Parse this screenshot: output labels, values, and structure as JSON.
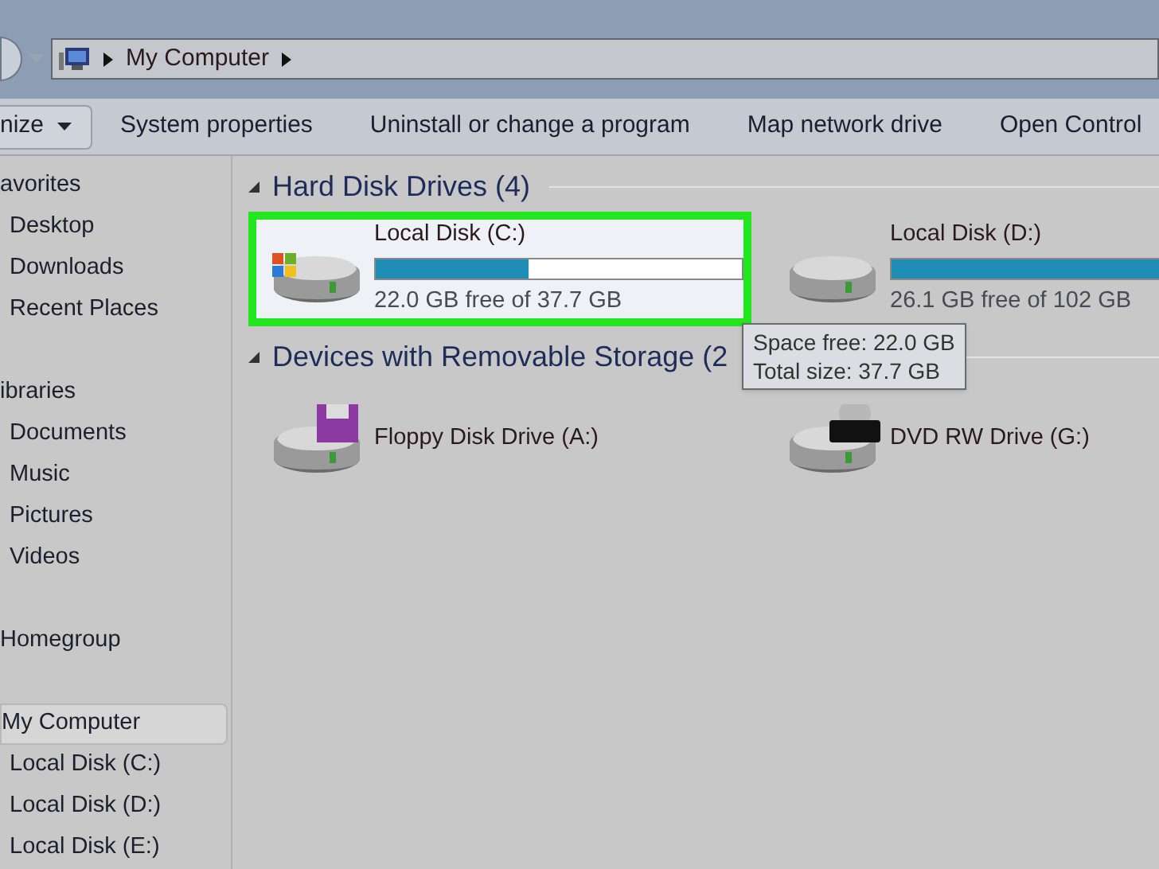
{
  "address_bar": {
    "path": [
      "My Computer"
    ]
  },
  "toolbar": {
    "items": [
      {
        "label": "nize",
        "kind": "menu"
      },
      {
        "label": "System properties",
        "kind": "button"
      },
      {
        "label": "Uninstall or change a program",
        "kind": "button"
      },
      {
        "label": "Map network drive",
        "kind": "button"
      },
      {
        "label": "Open Control",
        "kind": "button"
      }
    ]
  },
  "sidebar": {
    "groups": [
      {
        "label": "avorites",
        "selected": false,
        "children": [
          {
            "label": "Desktop"
          },
          {
            "label": "Downloads"
          },
          {
            "label": "Recent Places"
          }
        ]
      },
      {
        "label": "ibraries",
        "selected": false,
        "children": [
          {
            "label": "Documents"
          },
          {
            "label": "Music"
          },
          {
            "label": "Pictures"
          },
          {
            "label": "Videos"
          }
        ]
      },
      {
        "label": "Homegroup",
        "selected": false
      },
      {
        "label": "My Computer",
        "selected": true,
        "children": [
          {
            "label": "Local Disk (C:)"
          },
          {
            "label": "Local Disk (D:)"
          },
          {
            "label": "Local Disk (E:)"
          }
        ]
      }
    ]
  },
  "sections": [
    {
      "title": "Hard Disk Drives (4)",
      "items": [
        {
          "name": "Local Disk (C:)",
          "kind": "system-disk",
          "level": 0.416,
          "free": "22.0 GB free of 37.7 GB",
          "selected": true
        },
        {
          "name": "Local Disk (D:)",
          "kind": "disk",
          "level": 0.74,
          "free": "26.1 GB free of 102 GB",
          "selected": false
        }
      ]
    },
    {
      "title": "Devices with Removable Storage (2",
      "items": [
        {
          "name": "Floppy Disk Drive (A:)",
          "kind": "floppy",
          "selected": false
        },
        {
          "name": "DVD RW Drive (G:)",
          "kind": "dvd",
          "selected": false
        }
      ]
    }
  ],
  "tooltip": {
    "lines": [
      "Space free: 22.0 GB",
      "Total size: 37.7 GB"
    ]
  }
}
